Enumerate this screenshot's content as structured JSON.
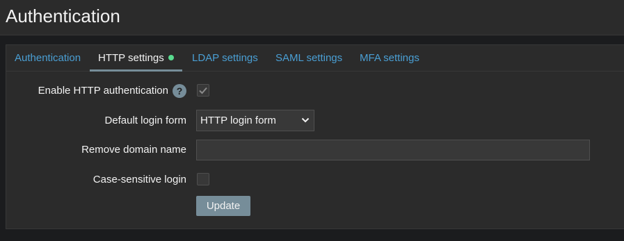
{
  "header": {
    "title": "Authentication"
  },
  "tabs": [
    {
      "label": "Authentication",
      "active": false
    },
    {
      "label": "HTTP settings",
      "active": true,
      "indicator_color": "#59db8f"
    },
    {
      "label": "LDAP settings",
      "active": false
    },
    {
      "label": "SAML settings",
      "active": false
    },
    {
      "label": "MFA settings",
      "active": false
    }
  ],
  "form": {
    "enable_http_auth": {
      "label": "Enable HTTP authentication",
      "checked": true,
      "help_icon": "?"
    },
    "default_login_form": {
      "label": "Default login form",
      "value": "HTTP login form"
    },
    "remove_domain_name": {
      "label": "Remove domain name",
      "value": ""
    },
    "case_sensitive_login": {
      "label": "Case-sensitive login",
      "checked": false
    },
    "update_label": "Update"
  },
  "colors": {
    "link": "#4a9fd4",
    "accent": "#768d99",
    "status_dot": "#59db8f"
  }
}
